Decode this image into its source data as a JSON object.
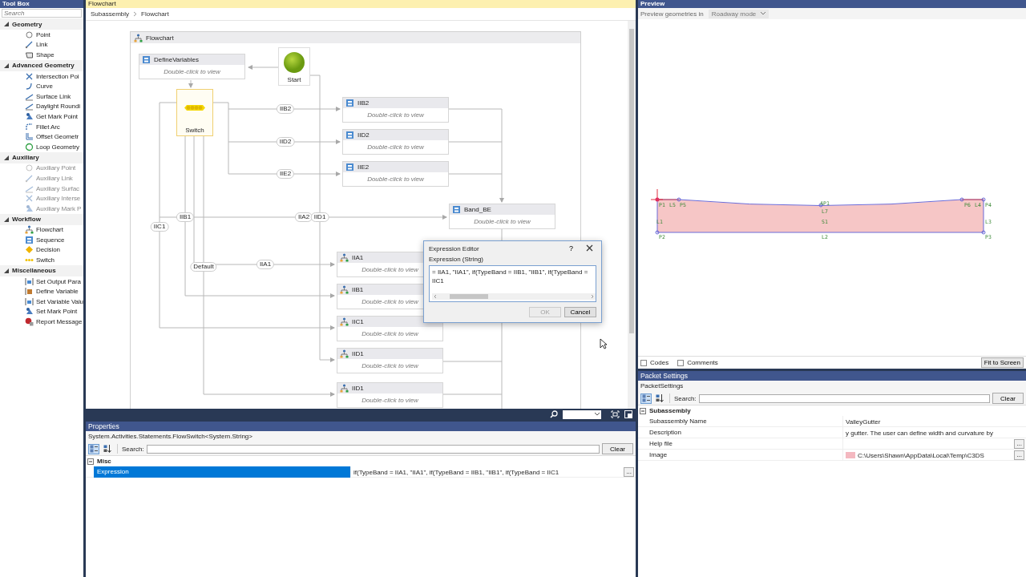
{
  "toolbox": {
    "title": "Tool Box",
    "search": {
      "placeholder": "Search"
    },
    "groups": [
      {
        "label": "Geometry",
        "expanded": true,
        "items": [
          {
            "label": "Point",
            "disabled": false
          },
          {
            "label": "Link",
            "disabled": false
          },
          {
            "label": "Shape",
            "disabled": false
          }
        ]
      },
      {
        "label": "Advanced Geometry",
        "expanded": true,
        "items": [
          {
            "label": "Intersection Poi",
            "disabled": false
          },
          {
            "label": "Curve",
            "disabled": false
          },
          {
            "label": "Surface Link",
            "disabled": false
          },
          {
            "label": "Daylight Roundi",
            "disabled": false
          },
          {
            "label": "Get Mark Point",
            "disabled": false
          },
          {
            "label": "Fillet Arc",
            "disabled": false
          },
          {
            "label": "Offset Geometr",
            "disabled": false
          },
          {
            "label": "Loop Geometry",
            "disabled": false
          }
        ]
      },
      {
        "label": "Auxiliary",
        "expanded": true,
        "items": [
          {
            "label": "Auxiliary Point",
            "disabled": true
          },
          {
            "label": "Auxiliary Link",
            "disabled": true
          },
          {
            "label": "Auxiliary Surfac",
            "disabled": true
          },
          {
            "label": "Auxiliary Interse",
            "disabled": true
          },
          {
            "label": "Auxiliary Mark P",
            "disabled": true
          }
        ]
      },
      {
        "label": "Workflow",
        "expanded": true,
        "items": [
          {
            "label": "Flowchart",
            "disabled": false
          },
          {
            "label": "Sequence",
            "disabled": false
          },
          {
            "label": "Decision",
            "disabled": false
          },
          {
            "label": "Switch",
            "disabled": false
          }
        ]
      },
      {
        "label": "Miscellaneous",
        "expanded": true,
        "items": [
          {
            "label": "Set Output Para",
            "disabled": false
          },
          {
            "label": "Define Variable",
            "disabled": false
          },
          {
            "label": "Set Variable Valu",
            "disabled": false
          },
          {
            "label": "Set Mark Point",
            "disabled": false
          },
          {
            "label": "Report Message",
            "disabled": false
          }
        ]
      }
    ]
  },
  "flowchart": {
    "tab_title": "Flowchart",
    "breadcrumb": [
      "Subassembly",
      "Flowchart"
    ],
    "container_title": "Flowchart",
    "nodes": [
      {
        "kind": "sequence",
        "title": "DefineVariables",
        "hint": "Double-click to view"
      },
      {
        "kind": "start",
        "title": "Start"
      },
      {
        "kind": "switch",
        "title": "Switch"
      },
      {
        "kind": "sequence",
        "title": "IIB2",
        "hint": "Double-click to view"
      },
      {
        "kind": "sequence",
        "title": "IID2",
        "hint": "Double-click to view"
      },
      {
        "kind": "sequence",
        "title": "IIE2",
        "hint": "Double-click to view"
      },
      {
        "kind": "sequence",
        "title": "Band_BE",
        "hint": "Double-click to view"
      },
      {
        "kind": "flowchart",
        "title": "IIA1",
        "hint": "Double-click to view"
      },
      {
        "kind": "flowchart",
        "title": "IIB1",
        "hint": "Double-click to view"
      },
      {
        "kind": "flowchart",
        "title": "IIC1",
        "hint": "Double-click to view"
      },
      {
        "kind": "flowchart",
        "title": "IID1",
        "hint": "Double-click to view"
      },
      {
        "kind": "flowchart",
        "title": "IID1",
        "hint": "Double-click to view"
      }
    ],
    "edge_labels": [
      "IIB2",
      "IID2",
      "IIE2",
      "IIB1",
      "IIA2",
      "IID1",
      "IIC1",
      "Default",
      "IIA1"
    ]
  },
  "expression_editor": {
    "title": "Expression Editor",
    "help": "?",
    "label": "Expression (String)",
    "value": "= IIA1, \"IIA1\", if(TypeBand = IIB1, \"IIB1\", if(TypeBand = IIC1",
    "buttons": [
      {
        "label": "OK",
        "disabled": true
      },
      {
        "label": "Cancel",
        "disabled": false
      }
    ]
  },
  "properties": {
    "title": "Properties",
    "subtitle": "System.Activities.Statements.FlowSwitch<System.String>",
    "view_buttons": [
      {
        "kind": "categorized",
        "selected": true
      },
      {
        "kind": "alphabetical",
        "selected": false
      }
    ],
    "search_label": "Search:",
    "clear": "Clear",
    "categories": [
      {
        "label": "Misc",
        "expanded": true,
        "rows": [
          {
            "kind": "text",
            "name": "Expression",
            "value": "if(TypeBand = IIA1, \"IIA1\", if(TypeBand = IIB1, \"IIB1\", if(TypeBand = IIC1",
            "selected": true,
            "button": "..."
          }
        ]
      }
    ]
  },
  "preview": {
    "title": "Preview",
    "mode_label": "Preview geometries in",
    "mode": "Roadway mode",
    "labels": [
      "P1",
      "L5",
      "P5",
      "AP1",
      "L7",
      "P6",
      "L4",
      "P4",
      "L1",
      "S1",
      "L3",
      "P2",
      "L2",
      "P3"
    ],
    "options": [
      {
        "label": "Codes",
        "checked": false
      },
      {
        "label": "Comments",
        "checked": false
      }
    ],
    "fit_button": "Fit to Screen"
  },
  "packet_settings": {
    "title": "Packet Settings",
    "subtitle": "PacketSettings",
    "view_buttons": [
      {
        "kind": "categorized",
        "selected": true
      },
      {
        "kind": "alphabetical",
        "selected": false
      }
    ],
    "search_label": "Search:",
    "clear": "Clear",
    "categories": [
      {
        "label": "Subassembly",
        "expanded": true,
        "rows": [
          {
            "kind": "text",
            "name": "Subassembly Name",
            "value": "ValleyGutter",
            "selected": false
          },
          {
            "kind": "text",
            "name": "Description",
            "value": "y gutter. The user can define width and curvature by",
            "selected": false
          },
          {
            "kind": "text",
            "name": "Help file",
            "selected": false,
            "button": "..."
          },
          {
            "kind": "image",
            "name": "Image",
            "value": "C:\\Users\\Shawn\\AppData\\Local\\Temp\\C3DS",
            "selected": false,
            "button": "..."
          }
        ]
      }
    ]
  }
}
